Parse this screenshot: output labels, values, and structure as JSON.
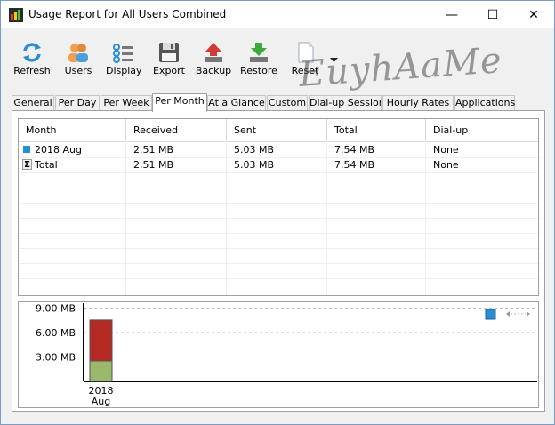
{
  "window": {
    "title": "Usage Report for All Users Combined",
    "controls": {
      "minimize": "—",
      "maximize": "☐",
      "close": "✕"
    }
  },
  "toolbar": {
    "refresh": "Refresh",
    "users": "Users",
    "display": "Display",
    "export": "Export",
    "backup": "Backup",
    "restore": "Restore",
    "reset": "Reset"
  },
  "tabs": [
    {
      "label": "General"
    },
    {
      "label": "Per Day"
    },
    {
      "label": "Per Week"
    },
    {
      "label": "Per Month",
      "active": true
    },
    {
      "label": "At a Glance"
    },
    {
      "label": "Custom"
    },
    {
      "label": "Dial-up Session"
    },
    {
      "label": "Hourly Rates"
    },
    {
      "label": "Applications"
    }
  ],
  "table": {
    "headers": [
      "Month",
      "Received",
      "Sent",
      "Total",
      "Dial-up"
    ],
    "rows": [
      {
        "month": "2018 Aug",
        "received": "2.51 MB",
        "sent": "5.03 MB",
        "total": "7.54 MB",
        "dialup": "None",
        "icon": "square-icon"
      },
      {
        "month": "Total",
        "received": "2.51 MB",
        "sent": "5.03 MB",
        "total": "7.54 MB",
        "dialup": "None",
        "icon": "sigma-icon"
      }
    ]
  },
  "chart_data": {
    "type": "bar",
    "categories": [
      "2018 Aug"
    ],
    "category_label_lines": [
      "2018",
      "Aug"
    ],
    "series": [
      {
        "values": [
          2.51
        ],
        "color": "#9cb86a"
      },
      {
        "values": [
          5.03
        ],
        "color": "#b52a22"
      }
    ],
    "stacked": true,
    "yticks": [
      "3.00 MB",
      "6.00 MB",
      "9.00 MB"
    ],
    "ytick_values": [
      3,
      6,
      9
    ],
    "ylim": [
      0,
      9.6
    ],
    "grid": true
  },
  "watermark": "EuyhAaMe",
  "colors": {
    "accent": "#2a8dd4",
    "received": "#9cb86a",
    "sent": "#b52a22"
  }
}
